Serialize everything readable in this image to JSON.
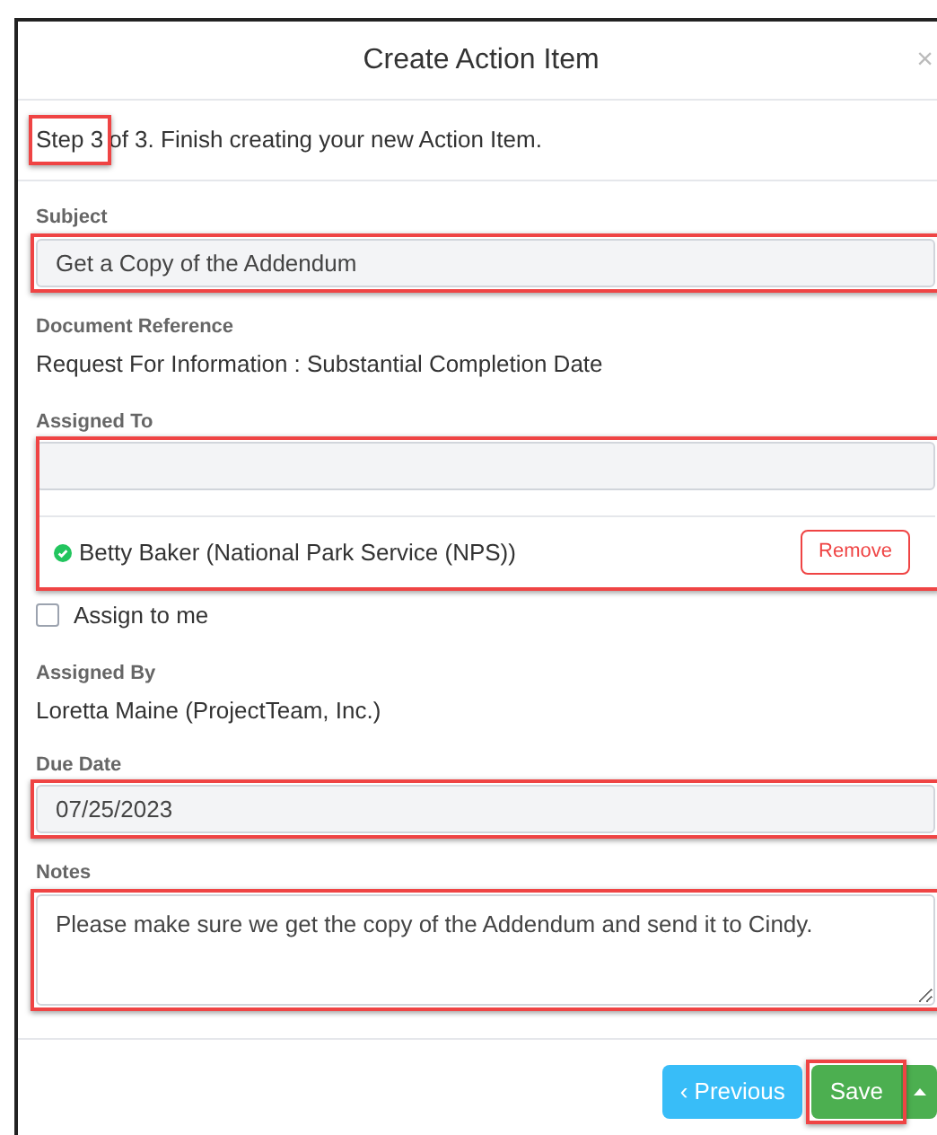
{
  "dialog": {
    "title": "Create Action Item",
    "close": "×"
  },
  "step": {
    "current": "Step 3",
    "rest": "of 3. Finish creating your new Action Item.",
    "highlighted": true
  },
  "fields": [
    {
      "kind": "input",
      "label": "Subject",
      "value": "Get a Copy of the Addendum",
      "highlighted": true
    },
    {
      "kind": "text",
      "label": "Document Reference",
      "value": "Request For Information : Substantial Completion Date"
    },
    {
      "kind": "assignees",
      "label": "Assigned To",
      "highlighted": true,
      "assignees": [
        {
          "name": "Betty Baker (National Park Service (NPS))",
          "action": "Remove"
        }
      ]
    },
    {
      "kind": "checkbox",
      "label": "Assign to me",
      "checked": false
    },
    {
      "kind": "text",
      "label": "Assigned By",
      "value": "Loretta Maine (ProjectTeam, Inc.)"
    },
    {
      "kind": "input",
      "label": "Due Date",
      "value": "07/25/2023",
      "highlighted": true
    },
    {
      "kind": "textarea",
      "label": "Notes",
      "value": "Please make sure we get the copy of the Addendum and send it to Cindy.",
      "highlighted": true
    }
  ],
  "buttons": [
    {
      "kind": "previous",
      "label": "‹ Previous"
    },
    {
      "kind": "save",
      "label": "Save",
      "highlighted": true
    },
    {
      "kind": "menu"
    }
  ]
}
